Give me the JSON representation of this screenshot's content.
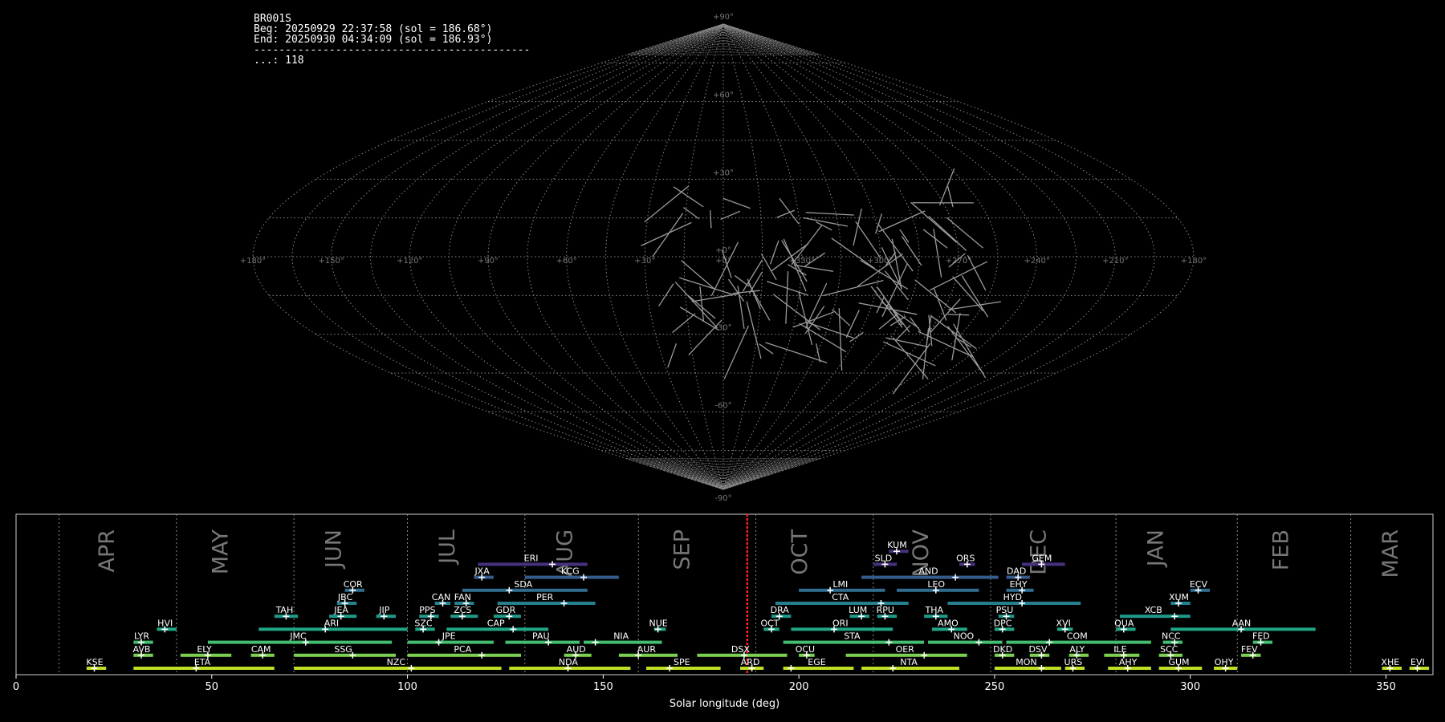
{
  "header": {
    "station": "BR001S",
    "begin": "Beg: 20250929 22:37:58 (sol = 186.68°)",
    "end": "End: 20250930 04:34:09 (sol = 186.93°)",
    "separator": "--------------------------------------------",
    "count": "...: 118"
  },
  "colors": {
    "background": "#000000",
    "grid": "#888888",
    "trail": "#9a9a9a",
    "current": "#ff2020"
  },
  "chart_data": [
    {
      "type": "sky-map",
      "projection": "sinusoidal",
      "lat_labels": [
        "+90°",
        "+60°",
        "+30°",
        "+0°",
        "-30°",
        "-60°",
        "-90°"
      ],
      "lon_labels": [
        "+180°",
        "+150°",
        "+120°",
        "+90°",
        "+60°",
        "+30°",
        "+0°",
        "+330°",
        "+300°",
        "+270°",
        "+240°",
        "+210°",
        "+180°"
      ],
      "meteor_count": 118
    },
    {
      "type": "timeline",
      "xlabel": "Solar longitude (deg)",
      "xlim": [
        0,
        362
      ],
      "xticks": [
        0,
        50,
        100,
        150,
        200,
        250,
        300,
        350
      ],
      "current_sol": [
        186.68,
        186.93
      ],
      "month_boundaries": [
        11,
        41,
        71,
        100,
        130,
        159,
        189,
        219,
        249,
        281,
        312,
        341
      ],
      "months": [
        {
          "name": "APR",
          "x": 25
        },
        {
          "name": "MAY",
          "x": 54
        },
        {
          "name": "JUN",
          "x": 83
        },
        {
          "name": "JUL",
          "x": 112
        },
        {
          "name": "AUG",
          "x": 142
        },
        {
          "name": "SEP",
          "x": 172
        },
        {
          "name": "OCT",
          "x": 202
        },
        {
          "name": "NOV",
          "x": 233
        },
        {
          "name": "DEC",
          "x": 263
        },
        {
          "name": "JAN",
          "x": 293
        },
        {
          "name": "FEB",
          "x": 325
        },
        {
          "name": "MAR",
          "x": 353
        }
      ],
      "showers": [
        {
          "code": "KUM",
          "start": 223,
          "end": 228,
          "peak": 225,
          "row": 9,
          "color": "#46327e"
        },
        {
          "code": "ERI",
          "start": 118,
          "end": 146,
          "peak": 137,
          "row": 8,
          "color": "#46327e"
        },
        {
          "code": "SLD",
          "start": 219,
          "end": 225,
          "peak": 222,
          "row": 8,
          "color": "#46327e"
        },
        {
          "code": "ORS",
          "start": 241,
          "end": 245,
          "peak": 243,
          "row": 8,
          "color": "#46327e"
        },
        {
          "code": "GEM",
          "start": 257,
          "end": 268,
          "peak": 262,
          "row": 8,
          "color": "#46327e"
        },
        {
          "code": "JXA",
          "start": 117,
          "end": 122,
          "peak": 119,
          "row": 7,
          "color": "#365c8d"
        },
        {
          "code": "KCG",
          "start": 130,
          "end": 154,
          "peak": 145,
          "row": 7,
          "color": "#365c8d"
        },
        {
          "code": "AND",
          "start": 216,
          "end": 251,
          "peak": 240,
          "row": 7,
          "color": "#365c8d"
        },
        {
          "code": "DAD",
          "start": 253,
          "end": 259,
          "peak": 256,
          "row": 7,
          "color": "#365c8d"
        },
        {
          "code": "COR",
          "start": 84,
          "end": 89,
          "peak": 86,
          "row": 6,
          "color": "#2f6c8e"
        },
        {
          "code": "SDA",
          "start": 114,
          "end": 146,
          "peak": 126,
          "row": 6,
          "color": "#2f6c8e"
        },
        {
          "code": "LMI",
          "start": 200,
          "end": 222,
          "peak": 208,
          "row": 6,
          "color": "#2f6c8e"
        },
        {
          "code": "LEO",
          "start": 225,
          "end": 246,
          "peak": 235,
          "row": 6,
          "color": "#2f6c8e"
        },
        {
          "code": "EHY",
          "start": 253,
          "end": 260,
          "peak": 257,
          "row": 6,
          "color": "#2f6c8e"
        },
        {
          "code": "ECV",
          "start": 300,
          "end": 305,
          "peak": 302,
          "row": 6,
          "color": "#2f6c8e"
        },
        {
          "code": "JBC",
          "start": 82,
          "end": 87,
          "peak": 84,
          "row": 5,
          "color": "#277f8e"
        },
        {
          "code": "CAN",
          "start": 107,
          "end": 111,
          "peak": 109,
          "row": 5,
          "color": "#277f8e"
        },
        {
          "code": "FAN",
          "start": 112,
          "end": 117,
          "peak": 115,
          "row": 5,
          "color": "#277f8e"
        },
        {
          "code": "PER",
          "start": 123,
          "end": 148,
          "peak": 140,
          "row": 5,
          "color": "#277f8e"
        },
        {
          "code": "CTA",
          "start": 194,
          "end": 228,
          "peak": 221,
          "row": 5,
          "color": "#277f8e"
        },
        {
          "code": "HYD",
          "start": 238,
          "end": 272,
          "peak": 257,
          "row": 5,
          "color": "#277f8e"
        },
        {
          "code": "XUM",
          "start": 295,
          "end": 300,
          "peak": 297,
          "row": 5,
          "color": "#277f8e"
        },
        {
          "code": "TAH",
          "start": 66,
          "end": 72,
          "peak": 69,
          "row": 4,
          "color": "#1f9a8a"
        },
        {
          "code": "JEA",
          "start": 80,
          "end": 87,
          "peak": 83,
          "row": 4,
          "color": "#1f9a8a"
        },
        {
          "code": "JIP",
          "start": 92,
          "end": 97,
          "peak": 94,
          "row": 4,
          "color": "#1f9a8a"
        },
        {
          "code": "PPS",
          "start": 103,
          "end": 108,
          "peak": 106,
          "row": 4,
          "color": "#1f9a8a"
        },
        {
          "code": "ZCS",
          "start": 111,
          "end": 118,
          "peak": 114,
          "row": 4,
          "color": "#1f9a8a"
        },
        {
          "code": "GDR",
          "start": 122,
          "end": 129,
          "peak": 126,
          "row": 4,
          "color": "#1f9a8a"
        },
        {
          "code": "DRA",
          "start": 193,
          "end": 198,
          "peak": 195,
          "row": 4,
          "color": "#1f9a8a"
        },
        {
          "code": "LUM",
          "start": 213,
          "end": 218,
          "peak": 216,
          "row": 4,
          "color": "#1f9a8a"
        },
        {
          "code": "RPU",
          "start": 220,
          "end": 225,
          "peak": 222,
          "row": 4,
          "color": "#1f9a8a"
        },
        {
          "code": "THA",
          "start": 232,
          "end": 238,
          "peak": 235,
          "row": 4,
          "color": "#1f9a8a"
        },
        {
          "code": "PSU",
          "start": 251,
          "end": 255,
          "peak": 253,
          "row": 4,
          "color": "#1f9a8a"
        },
        {
          "code": "XCB",
          "start": 282,
          "end": 300,
          "peak": 296,
          "row": 4,
          "color": "#1f9a8a"
        },
        {
          "code": "HVI",
          "start": 36,
          "end": 41,
          "peak": 38,
          "row": 3,
          "color": "#21a685"
        },
        {
          "code": "ARI",
          "start": 62,
          "end": 100,
          "peak": 79,
          "row": 3,
          "color": "#21a685"
        },
        {
          "code": "SZC",
          "start": 102,
          "end": 107,
          "peak": 104,
          "row": 3,
          "color": "#21a685"
        },
        {
          "code": "CAP",
          "start": 110,
          "end": 136,
          "peak": 127,
          "row": 3,
          "color": "#21a685"
        },
        {
          "code": "NUE",
          "start": 163,
          "end": 166,
          "peak": 164,
          "row": 3,
          "color": "#21a685"
        },
        {
          "code": "OCT",
          "start": 191,
          "end": 195,
          "peak": 193,
          "row": 3,
          "color": "#21a685"
        },
        {
          "code": "ORI",
          "start": 198,
          "end": 224,
          "peak": 209,
          "row": 3,
          "color": "#21a685"
        },
        {
          "code": "AMO",
          "start": 234,
          "end": 243,
          "peak": 239,
          "row": 3,
          "color": "#21a685"
        },
        {
          "code": "DPC",
          "start": 250,
          "end": 255,
          "peak": 252,
          "row": 3,
          "color": "#21a685"
        },
        {
          "code": "XVI",
          "start": 266,
          "end": 270,
          "peak": 268,
          "row": 3,
          "color": "#21a685"
        },
        {
          "code": "QUA",
          "start": 281,
          "end": 286,
          "peak": 283,
          "row": 3,
          "color": "#21a685"
        },
        {
          "code": "AAN",
          "start": 295,
          "end": 332,
          "peak": 313,
          "row": 3,
          "color": "#21a685"
        },
        {
          "code": "LYR",
          "start": 30,
          "end": 35,
          "peak": 32,
          "row": 2,
          "color": "#44bf70"
        },
        {
          "code": "JMC",
          "start": 49,
          "end": 96,
          "peak": 74,
          "row": 2,
          "color": "#44bf70"
        },
        {
          "code": "JPE",
          "start": 100,
          "end": 122,
          "peak": 108,
          "row": 2,
          "color": "#44bf70"
        },
        {
          "code": "PAU",
          "start": 125,
          "end": 144,
          "peak": 136,
          "row": 2,
          "color": "#44bf70"
        },
        {
          "code": "NIA",
          "start": 145,
          "end": 165,
          "peak": 148,
          "row": 2,
          "color": "#44bf70"
        },
        {
          "code": "STA",
          "start": 196,
          "end": 232,
          "peak": 223,
          "row": 2,
          "color": "#44bf70"
        },
        {
          "code": "NOO",
          "start": 233,
          "end": 252,
          "peak": 246,
          "row": 2,
          "color": "#44bf70"
        },
        {
          "code": "COM",
          "start": 253,
          "end": 290,
          "peak": 264,
          "row": 2,
          "color": "#44bf70"
        },
        {
          "code": "NCC",
          "start": 293,
          "end": 298,
          "peak": 296,
          "row": 2,
          "color": "#44bf70"
        },
        {
          "code": "FED",
          "start": 316,
          "end": 321,
          "peak": 318,
          "row": 2,
          "color": "#44bf70"
        },
        {
          "code": "AVB",
          "start": 30,
          "end": 35,
          "peak": 32,
          "row": 1,
          "color": "#7ad151"
        },
        {
          "code": "ELY",
          "start": 42,
          "end": 55,
          "peak": 49,
          "row": 1,
          "color": "#7ad151"
        },
        {
          "code": "CAM",
          "start": 60,
          "end": 66,
          "peak": 63,
          "row": 1,
          "color": "#7ad151"
        },
        {
          "code": "SSG",
          "start": 71,
          "end": 97,
          "peak": 86,
          "row": 1,
          "color": "#7ad151"
        },
        {
          "code": "PCA",
          "start": 100,
          "end": 129,
          "peak": 119,
          "row": 1,
          "color": "#7ad151"
        },
        {
          "code": "AUD",
          "start": 140,
          "end": 147,
          "peak": 143,
          "row": 1,
          "color": "#7ad151"
        },
        {
          "code": "AUR",
          "start": 154,
          "end": 169,
          "peak": 159,
          "row": 1,
          "color": "#7ad151"
        },
        {
          "code": "DSX",
          "start": 174,
          "end": 197,
          "peak": 186,
          "row": 1,
          "color": "#7ad151"
        },
        {
          "code": "OCU",
          "start": 200,
          "end": 204,
          "peak": 202,
          "row": 1,
          "color": "#7ad151"
        },
        {
          "code": "OER",
          "start": 212,
          "end": 243,
          "peak": 232,
          "row": 1,
          "color": "#7ad151"
        },
        {
          "code": "DKD",
          "start": 250,
          "end": 255,
          "peak": 252,
          "row": 1,
          "color": "#7ad151"
        },
        {
          "code": "DSV",
          "start": 259,
          "end": 264,
          "peak": 262,
          "row": 1,
          "color": "#7ad151"
        },
        {
          "code": "ALY",
          "start": 269,
          "end": 274,
          "peak": 271,
          "row": 1,
          "color": "#7ad151"
        },
        {
          "code": "ILE",
          "start": 278,
          "end": 287,
          "peak": 283,
          "row": 1,
          "color": "#7ad151"
        },
        {
          "code": "SCC",
          "start": 292,
          "end": 298,
          "peak": 295,
          "row": 1,
          "color": "#7ad151"
        },
        {
          "code": "FEV",
          "start": 313,
          "end": 318,
          "peak": 316,
          "row": 1,
          "color": "#7ad151"
        },
        {
          "code": "KSE",
          "start": 18,
          "end": 23,
          "peak": 20,
          "row": 0,
          "color": "#bddf26"
        },
        {
          "code": "ETA",
          "start": 30,
          "end": 66,
          "peak": 46,
          "row": 0,
          "color": "#bddf26"
        },
        {
          "code": "NZC",
          "start": 71,
          "end": 124,
          "peak": 101,
          "row": 0,
          "color": "#bddf26"
        },
        {
          "code": "NDA",
          "start": 126,
          "end": 157,
          "peak": 141,
          "row": 0,
          "color": "#bddf26"
        },
        {
          "code": "SPE",
          "start": 161,
          "end": 180,
          "peak": 167,
          "row": 0,
          "color": "#bddf26"
        },
        {
          "code": "ARD",
          "start": 185,
          "end": 191,
          "peak": 188,
          "row": 0,
          "color": "#bddf26"
        },
        {
          "code": "EGE",
          "start": 196,
          "end": 214,
          "peak": 198,
          "row": 0,
          "color": "#bddf26"
        },
        {
          "code": "NTA",
          "start": 216,
          "end": 241,
          "peak": 224,
          "row": 0,
          "color": "#bddf26"
        },
        {
          "code": "MON",
          "start": 250,
          "end": 267,
          "peak": 262,
          "row": 0,
          "color": "#bddf26"
        },
        {
          "code": "URS",
          "start": 268,
          "end": 273,
          "peak": 270,
          "row": 0,
          "color": "#bddf26"
        },
        {
          "code": "AHY",
          "start": 279,
          "end": 290,
          "peak": 284,
          "row": 0,
          "color": "#bddf26"
        },
        {
          "code": "GUM",
          "start": 292,
          "end": 303,
          "peak": 297,
          "row": 0,
          "color": "#bddf26"
        },
        {
          "code": "OHY",
          "start": 306,
          "end": 312,
          "peak": 309,
          "row": 0,
          "color": "#bddf26"
        },
        {
          "code": "XHE",
          "start": 349,
          "end": 354,
          "peak": 351,
          "row": 0,
          "color": "#bddf26"
        },
        {
          "code": "EVI",
          "start": 356,
          "end": 361,
          "peak": 358,
          "row": 0,
          "color": "#bddf26"
        }
      ]
    }
  ]
}
